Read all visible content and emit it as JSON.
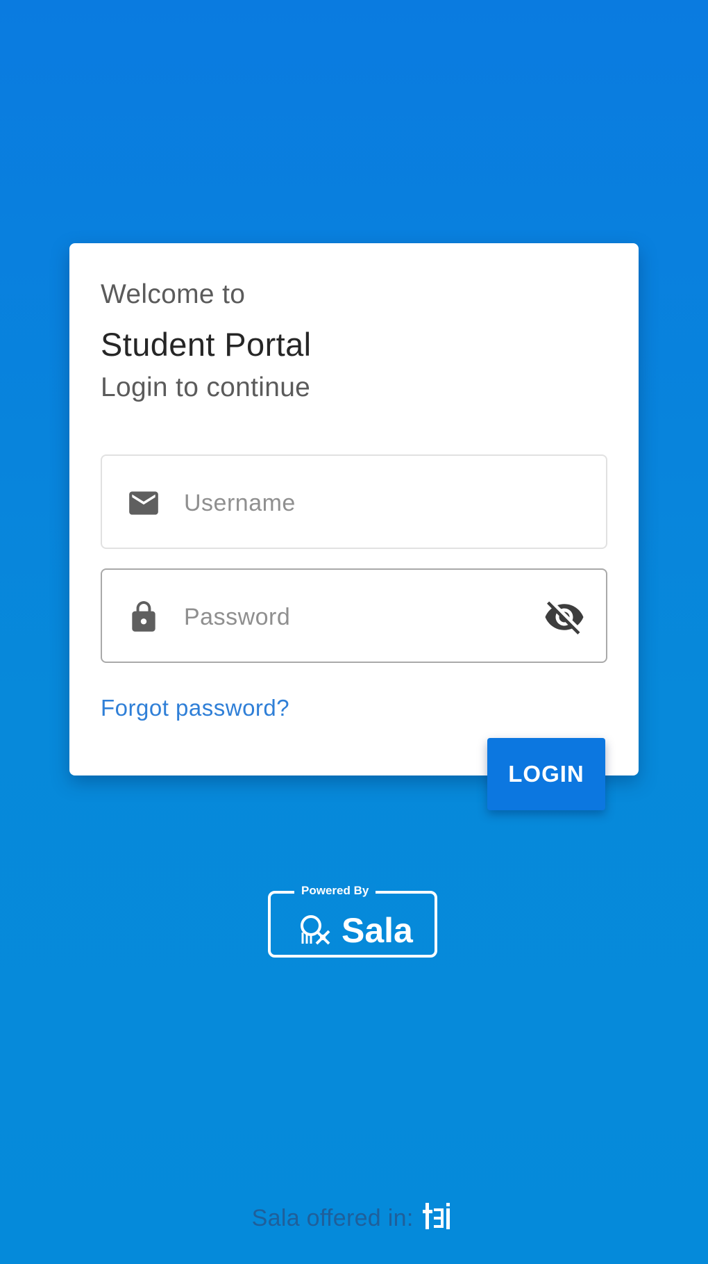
{
  "card": {
    "welcome": "Welcome to",
    "title": "Student Portal",
    "subtitle": "Login to continue"
  },
  "form": {
    "username": {
      "placeholder": "Username",
      "value": "",
      "icon": "mail-icon"
    },
    "password": {
      "placeholder": "Password",
      "value": "",
      "icon": "lock-icon",
      "toggle_icon": "eye-off-icon"
    },
    "forgot_label": "Forgot password?",
    "login_label": "LOGIN"
  },
  "branding": {
    "powered_label": "Powered By",
    "brand_name": "Sala"
  },
  "footer": {
    "text": "Sala offered in:",
    "logo_icon": "tgi-logo-icon"
  },
  "colors": {
    "background_top": "#0a7be0",
    "background_bottom": "#058ada",
    "accent": "#0c77e0",
    "link": "#2f7fd7",
    "card": "#ffffff"
  }
}
